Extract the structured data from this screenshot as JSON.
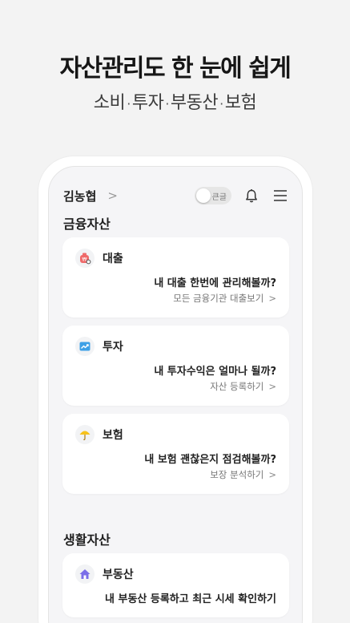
{
  "hero": {
    "title": "자산관리도 한 눈에 쉽게",
    "subtitle_parts": [
      "소비",
      "투자",
      "부동산",
      "보험"
    ],
    "separator": "·"
  },
  "topbar": {
    "user_name": "김농협",
    "chevron": ">",
    "toggle_label": "큰글",
    "toggle_on": false
  },
  "sections": {
    "financial": "금융자산",
    "living": "생활자산"
  },
  "cards": {
    "loan": {
      "name": "대출",
      "message": "내 대출 한번에 관리해볼까?",
      "link": "모든 금융기관 대출보기",
      "icon": "loan-icon",
      "color": "#ef6a6a"
    },
    "invest": {
      "name": "투자",
      "message": "내 투자수익은 얼마나 될까?",
      "link": "자산 등록하기",
      "icon": "chart-up-icon",
      "color": "#3ea0e6"
    },
    "insurance": {
      "name": "보험",
      "message": "내 보험 괜찮은지 점검해볼까?",
      "link": "보장 분석하기",
      "icon": "umbrella-icon",
      "color": "#f7c21b"
    },
    "realestate": {
      "name": "부동산",
      "message": "내 부동산 등록하고 최근 시세 확인하기",
      "icon": "house-icon",
      "color": "#7b6ee8"
    }
  },
  "link_arrow": ">"
}
